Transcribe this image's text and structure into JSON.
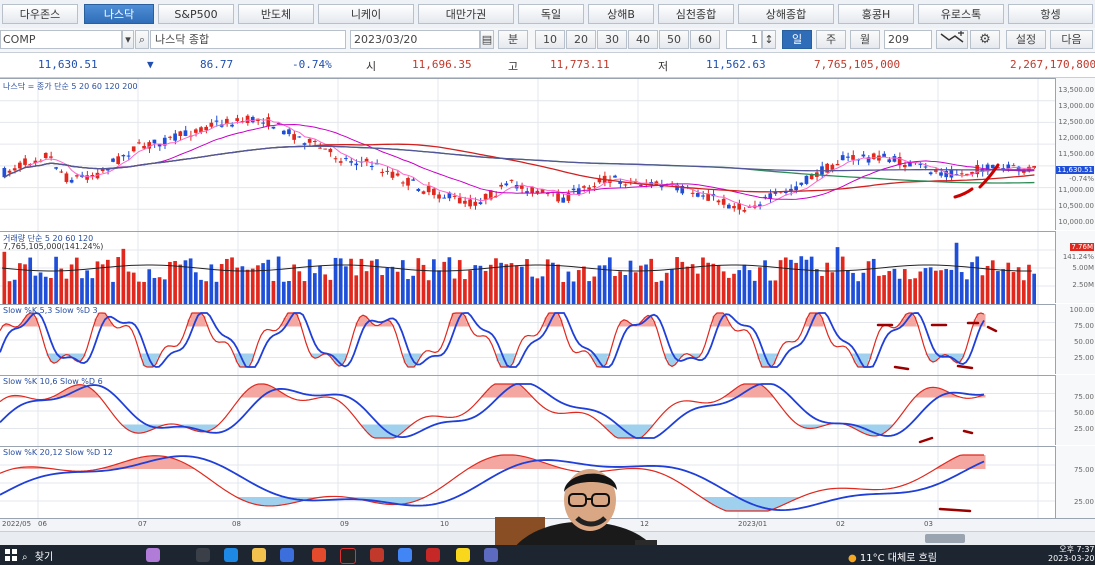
{
  "tabs": [
    {
      "label": "다우존스",
      "active": false
    },
    {
      "label": "나스닥",
      "active": true
    },
    {
      "label": "S&P500",
      "active": false
    },
    {
      "label": "반도체",
      "active": false
    },
    {
      "label": "니케이",
      "active": false
    },
    {
      "label": "대만가권",
      "active": false
    },
    {
      "label": "독일",
      "active": false
    },
    {
      "label": "상해B",
      "active": false
    },
    {
      "label": "심천종합",
      "active": false
    },
    {
      "label": "상해종합",
      "active": false
    },
    {
      "label": "홍콩H",
      "active": false
    },
    {
      "label": "유로스톡",
      "active": false
    },
    {
      "label": "항셍",
      "active": false
    }
  ],
  "toolbar": {
    "code": "COMP",
    "name": "나스닥 종합",
    "date": "2023/03/20",
    "minute_label": "분",
    "intervals": [
      "10",
      "20",
      "30",
      "40",
      "50",
      "60"
    ],
    "spin_value": "1",
    "periods": [
      {
        "label": "일",
        "selected": true
      },
      {
        "label": "주",
        "selected": false
      },
      {
        "label": "월",
        "selected": false
      }
    ],
    "count": "209",
    "settings_label": "설정",
    "next_label": "다음"
  },
  "quote": {
    "price": "11,630.51",
    "arrow": "▼",
    "change": "86.77",
    "change_pct": "-0.74%",
    "open_label": "시",
    "open": "11,696.35",
    "high_label": "고",
    "high": "11,773.11",
    "low_label": "저",
    "low": "11,562.63",
    "volume": "7,765,105,000",
    "amount": "2,267,170,800"
  },
  "panels": {
    "price_label": "나스닥 = 종가 단순 5 20 60 120 200",
    "volume_label_1": "거래량 단순 5 20 60 120",
    "volume_label_2": "7,765,105,000(141.24%)",
    "stoch1_label": "Slow %K 5,3  Slow %D 3",
    "stoch2_label": "Slow %K 10,6  Slow %D 6",
    "stoch3_label": "Slow %K 20,12  Slow %D 12"
  },
  "axes": {
    "price": [
      "13,500.00",
      "13,000.00",
      "12,500.00",
      "12,000.00",
      "11,500.00",
      "11,000.00",
      "10,500.00",
      "10,000.00"
    ],
    "price_current": "11,630.51",
    "price_pct": "-0.74%",
    "volume": [
      "7.76M",
      "141.24%",
      "5.00M",
      "2.50M"
    ],
    "stoch": [
      "100.00",
      "75.00",
      "50.00",
      "25.00"
    ],
    "stoch2": [
      "75.00",
      "50.00",
      "25.00"
    ],
    "stoch3": [
      "75.00",
      "25.00"
    ]
  },
  "xaxis": [
    "2022/05",
    "06",
    "07",
    "08",
    "09",
    "10",
    "12",
    "2023/01",
    "02",
    "03"
  ],
  "taskbar": {
    "search": "찾기",
    "weather": "11°C 대체로 흐림",
    "time": "오후 7:37",
    "date": "2023-03-20"
  },
  "colors": {
    "up": "#e0281e",
    "down": "#1f4fd8",
    "accent": "#2f6db8"
  }
}
